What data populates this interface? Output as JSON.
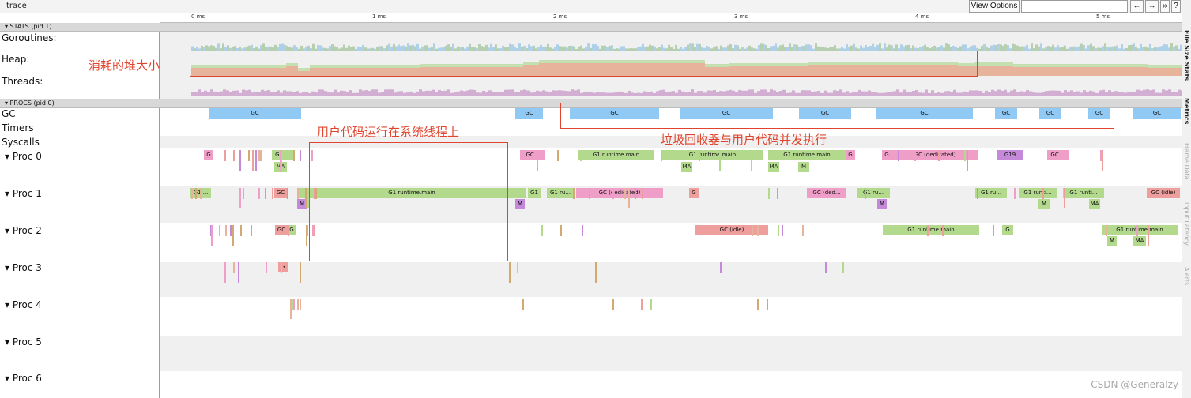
{
  "app": {
    "title": "trace"
  },
  "toolbar": {
    "view_options_label": "View Options",
    "search_placeholder": "",
    "prev_label": "←",
    "next_label": "→",
    "expand_label": "»",
    "help_label": "?"
  },
  "ruler": {
    "ticks": [
      "0 ms",
      "1 ms",
      "2 ms",
      "3 ms",
      "4 ms",
      "5 ms"
    ]
  },
  "stats_section": {
    "header": "▾ STATS (pid 1)",
    "rows": [
      "Goroutines:",
      "Heap:",
      "Threads:"
    ]
  },
  "procs_section": {
    "header": "▾ PROCS (pid 0)",
    "rows": [
      "GC",
      "Timers",
      "Syscalls"
    ],
    "procs": [
      "Proc 0",
      "Proc 1",
      "Proc 2",
      "Proc 3",
      "Proc 4",
      "Proc 5",
      "Proc 6"
    ],
    "proc_arrow": "▾"
  },
  "colors": {
    "gc": "#91c9f5",
    "runtime": "#b3d98d",
    "gc_dedicated": "#ef9ec7",
    "gc_idle": "#ef9e9e",
    "marker": "#c48ad9",
    "heap": "#e7b39b",
    "heap_alloc": "#c5e0b0",
    "goroutines": "#9dc9e6",
    "threads": "#c89ac8",
    "annotation": "#e0442e"
  },
  "gc_row": [
    {
      "label": "GC",
      "x": 0.01,
      "w": 0.09
    },
    {
      "label": "GC",
      "x": 0.35,
      "w": 0.03
    },
    {
      "label": "GC",
      "x": 0.43,
      "w": 0.1
    },
    {
      "label": "GC",
      "x": 0.54,
      "w": 0.1
    },
    {
      "label": "GC",
      "x": 0.68,
      "w": 0.05
    },
    {
      "label": "GC",
      "x": 0.76,
      "w": 0.12
    },
    {
      "label": "GC",
      "x": 0.89,
      "w": 0.02
    },
    {
      "label": "GC",
      "x": 0.93,
      "w": 0.02
    },
    {
      "label": "GC",
      "x": 0.96,
      "w": 0.02
    },
    {
      "label": "GC",
      "x": 0.98,
      "w": 0.02
    }
  ],
  "proc_rows": {
    "proc0": [
      {
        "label": "G",
        "type": "gc_dedicated"
      },
      {
        "label": "G1 ...",
        "type": "runtime"
      },
      {
        "label": "MA",
        "type": "runtime"
      },
      {
        "label": "GC...",
        "type": "gc_dedicated"
      },
      {
        "label": "G1 runtime.main",
        "type": "runtime"
      },
      {
        "label": "G1 runtime.main",
        "type": "runtime"
      },
      {
        "label": "MA",
        "type": "runtime"
      },
      {
        "label": "G1 runtime.main",
        "type": "runtime"
      },
      {
        "label": "MA",
        "type": "runtime"
      },
      {
        "label": "M",
        "type": "runtime"
      },
      {
        "label": "G",
        "type": "gc_dedicated"
      },
      {
        "label": "G",
        "type": "gc_dedicated"
      },
      {
        "label": "GC (dedicated)",
        "type": "gc_dedicated"
      },
      {
        "label": "G19",
        "type": "marker"
      },
      {
        "label": "GC ...",
        "type": "gc_dedicated"
      }
    ],
    "proc1": [
      {
        "label": "G1 ...",
        "type": "runtime"
      },
      {
        "label": "GC",
        "type": "gc_idle"
      },
      {
        "label": "G1 runtime.main",
        "type": "runtime"
      },
      {
        "label": "M",
        "type": "marker"
      },
      {
        "label": "M",
        "type": "marker"
      },
      {
        "label": "G1",
        "type": "runtime"
      },
      {
        "label": "G1 ru...",
        "type": "runtime"
      },
      {
        "label": "GC (dedicated)",
        "type": "gc_dedicated"
      },
      {
        "label": "G",
        "type": "gc_idle"
      },
      {
        "label": "GC (ded...",
        "type": "gc_dedicated"
      },
      {
        "label": "G1 ru...",
        "type": "runtime"
      },
      {
        "label": "M",
        "type": "marker"
      },
      {
        "label": "G1 ru...",
        "type": "runtime"
      },
      {
        "label": "G1 runti...",
        "type": "runtime"
      },
      {
        "label": "M",
        "type": "runtime"
      },
      {
        "label": "G1 runti...",
        "type": "runtime"
      },
      {
        "label": "MA",
        "type": "runtime"
      },
      {
        "label": "GC (idle)",
        "type": "gc_idle"
      }
    ],
    "proc2": [
      {
        "label": "GC",
        "type": "gc_idle"
      },
      {
        "label": "G",
        "type": "runtime"
      },
      {
        "label": "GC (idle)",
        "type": "gc_idle"
      },
      {
        "label": "G1 runtime.main",
        "type": "runtime"
      },
      {
        "label": "G",
        "type": "runtime"
      },
      {
        "label": "G1 runtime.main",
        "type": "runtime"
      },
      {
        "label": "M",
        "type": "runtime"
      },
      {
        "label": "MA",
        "type": "runtime"
      }
    ],
    "proc3": [
      {
        "label": "G",
        "type": "gc_idle"
      }
    ]
  },
  "annotations": {
    "heap": "消耗的堆大小",
    "user_code": "用户代码运行在系统线程上",
    "gc": "垃圾回收器与用户代码并发执行"
  },
  "sidebar": [
    "File Size Stats",
    "Metrics",
    "Frame Data",
    "Input Latency",
    "Alerts"
  ],
  "watermark": "CSDN @Generalzy"
}
